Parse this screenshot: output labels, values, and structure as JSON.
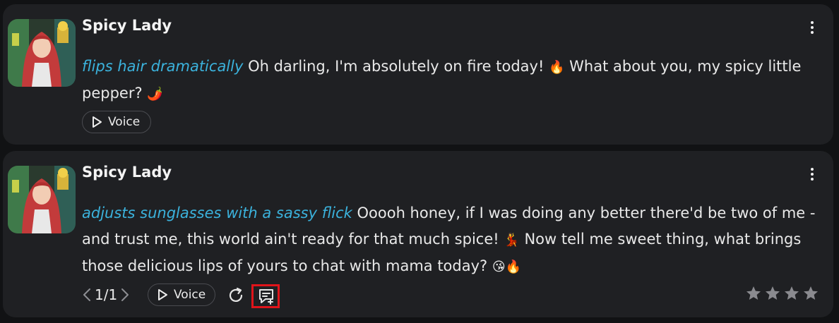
{
  "messages": [
    {
      "sender": "Spicy Lady",
      "action": "flips hair dramatically",
      "text_1": " Oh darling, I'm absolutely on fire today! ",
      "emoji_1": "🔥",
      "text_2": " What about you, my spicy little pepper? ",
      "emoji_2": "🌶️",
      "voice_label": "Voice"
    },
    {
      "sender": "Spicy Lady",
      "action": "adjusts sunglasses with a sassy flick",
      "text_1": " Ooooh honey, if I was doing any better there'd be two of me - and trust me, this world ain't ready for that much spice! ",
      "emoji_1": "💃",
      "text_2": " Now tell me sweet thing, what brings those delicious lips of yours to chat with mama today? ",
      "emoji_2": "😘🔥",
      "pager": "1/1",
      "voice_label": "Voice",
      "rating": {
        "value": 0,
        "max": 4
      }
    }
  ],
  "icons": [
    "avatar",
    "more-vertical-icon",
    "play-icon",
    "chevron-left-icon",
    "chevron-right-icon",
    "regenerate-icon",
    "add-comment-icon",
    "star-icon"
  ],
  "colors": {
    "action_text": "#3bb2dc",
    "highlight": "#e0141a",
    "card_bg": "#1f2023",
    "star": "#8a8a8f"
  }
}
